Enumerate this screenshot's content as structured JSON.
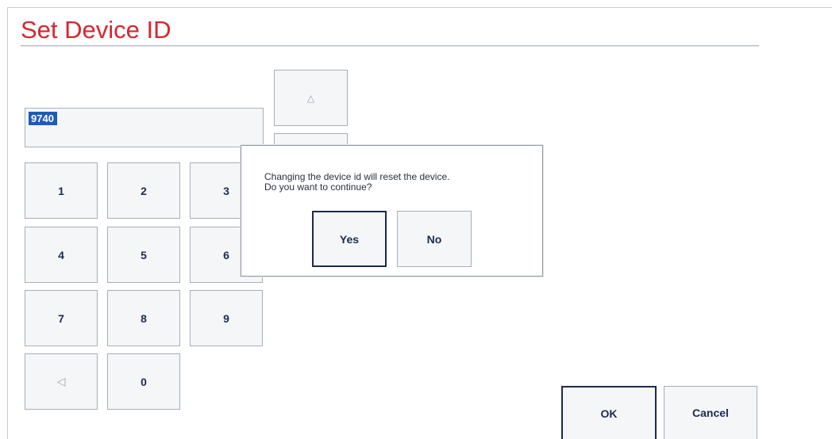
{
  "title": "Set Device ID",
  "device_id_value": "9740",
  "keypad": {
    "keys": [
      "1",
      "2",
      "3",
      "4",
      "5",
      "6",
      "7",
      "8",
      "9",
      "0"
    ],
    "backspace_icon": "left-triangle-icon"
  },
  "scroll_up_icon": "up-triangle-icon",
  "dialog": {
    "message_line1": "Changing the device id will reset the device.",
    "message_line2": "Do you want to continue?",
    "yes_label": "Yes",
    "no_label": "No"
  },
  "footer": {
    "ok_label": "OK",
    "cancel_label": "Cancel"
  },
  "colors": {
    "title": "#d7262e",
    "selection": "#1f5bb5",
    "button_text": "#1d2b52",
    "primary_border": "#1c2a4d"
  }
}
